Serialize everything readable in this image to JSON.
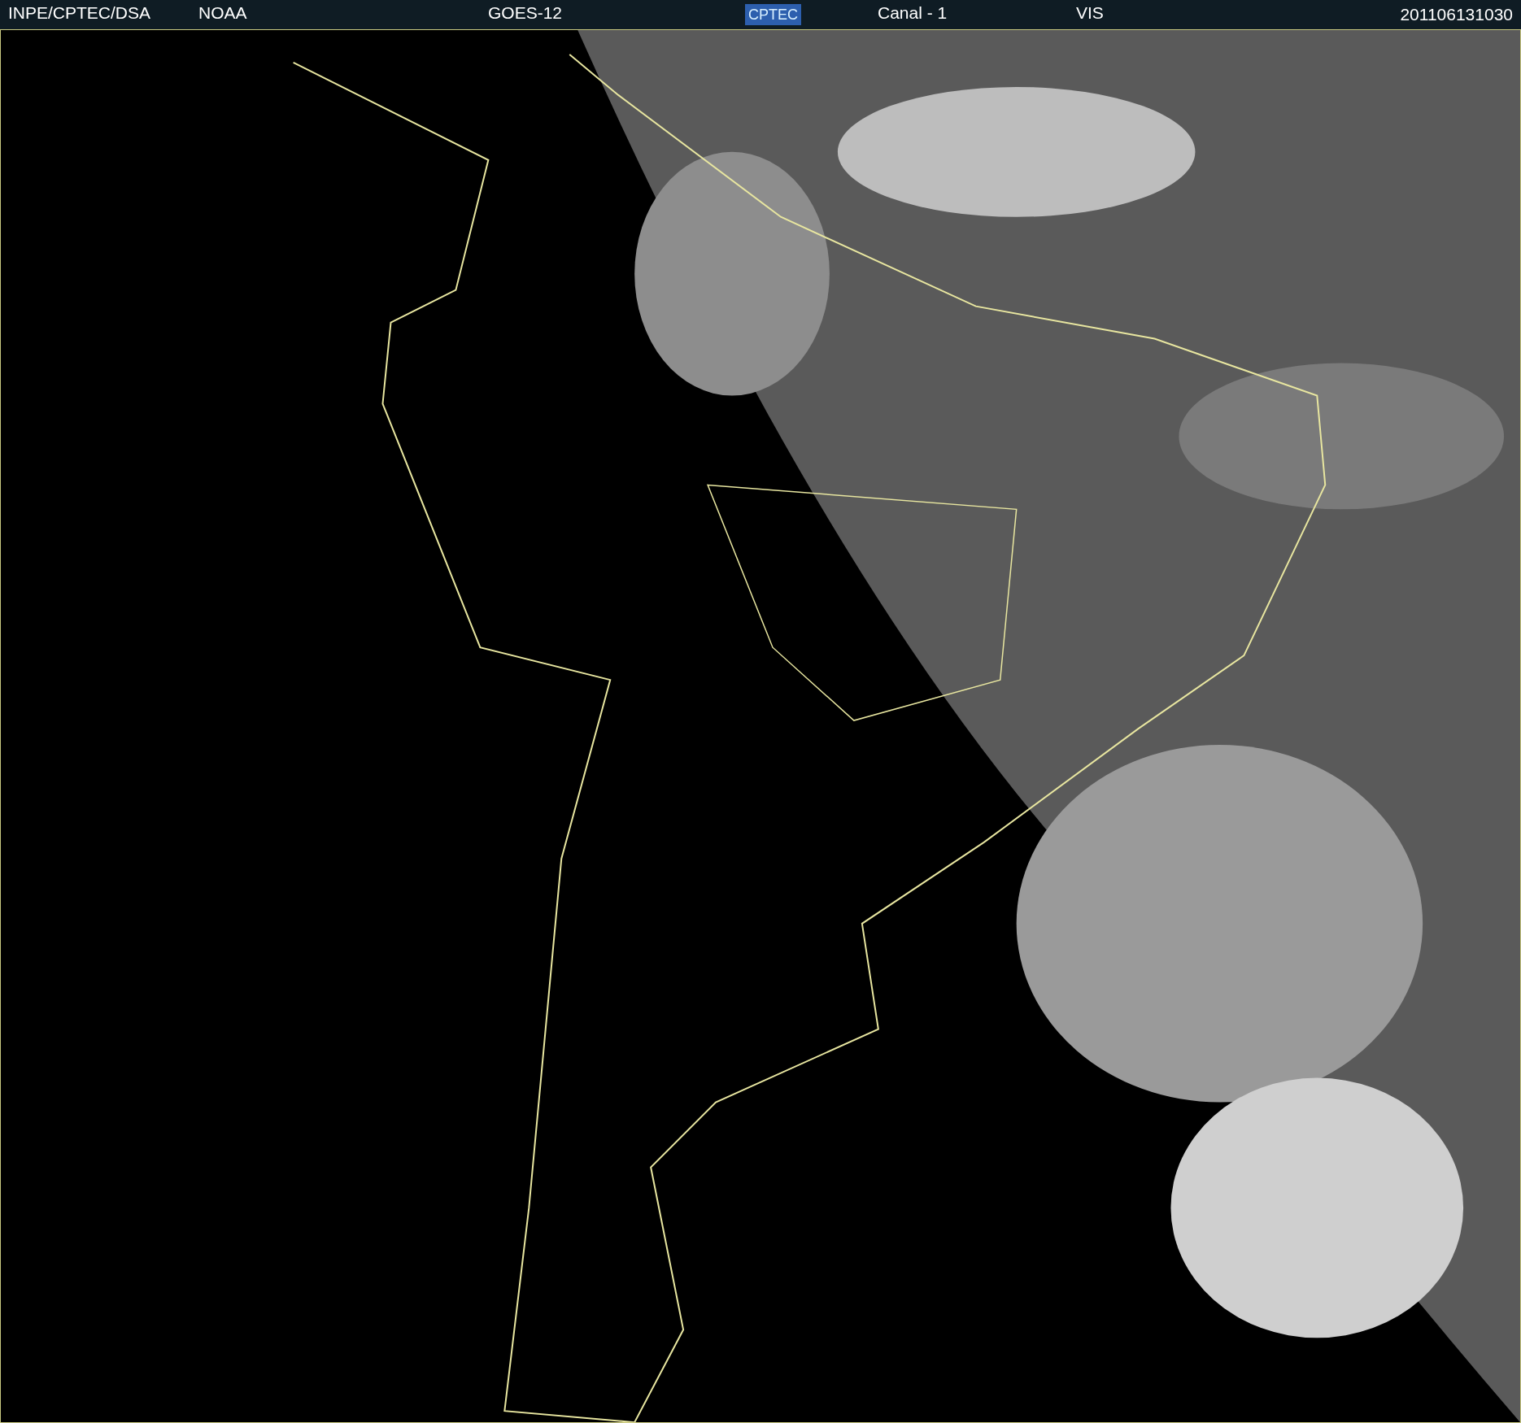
{
  "header": {
    "source": "INPE/CPTEC/DSA",
    "agency": "NOAA",
    "satellite": "GOES-12",
    "logo": "CPTEC",
    "channel": "Canal - 1",
    "band": "VIS",
    "timestamp": "201106131030"
  }
}
